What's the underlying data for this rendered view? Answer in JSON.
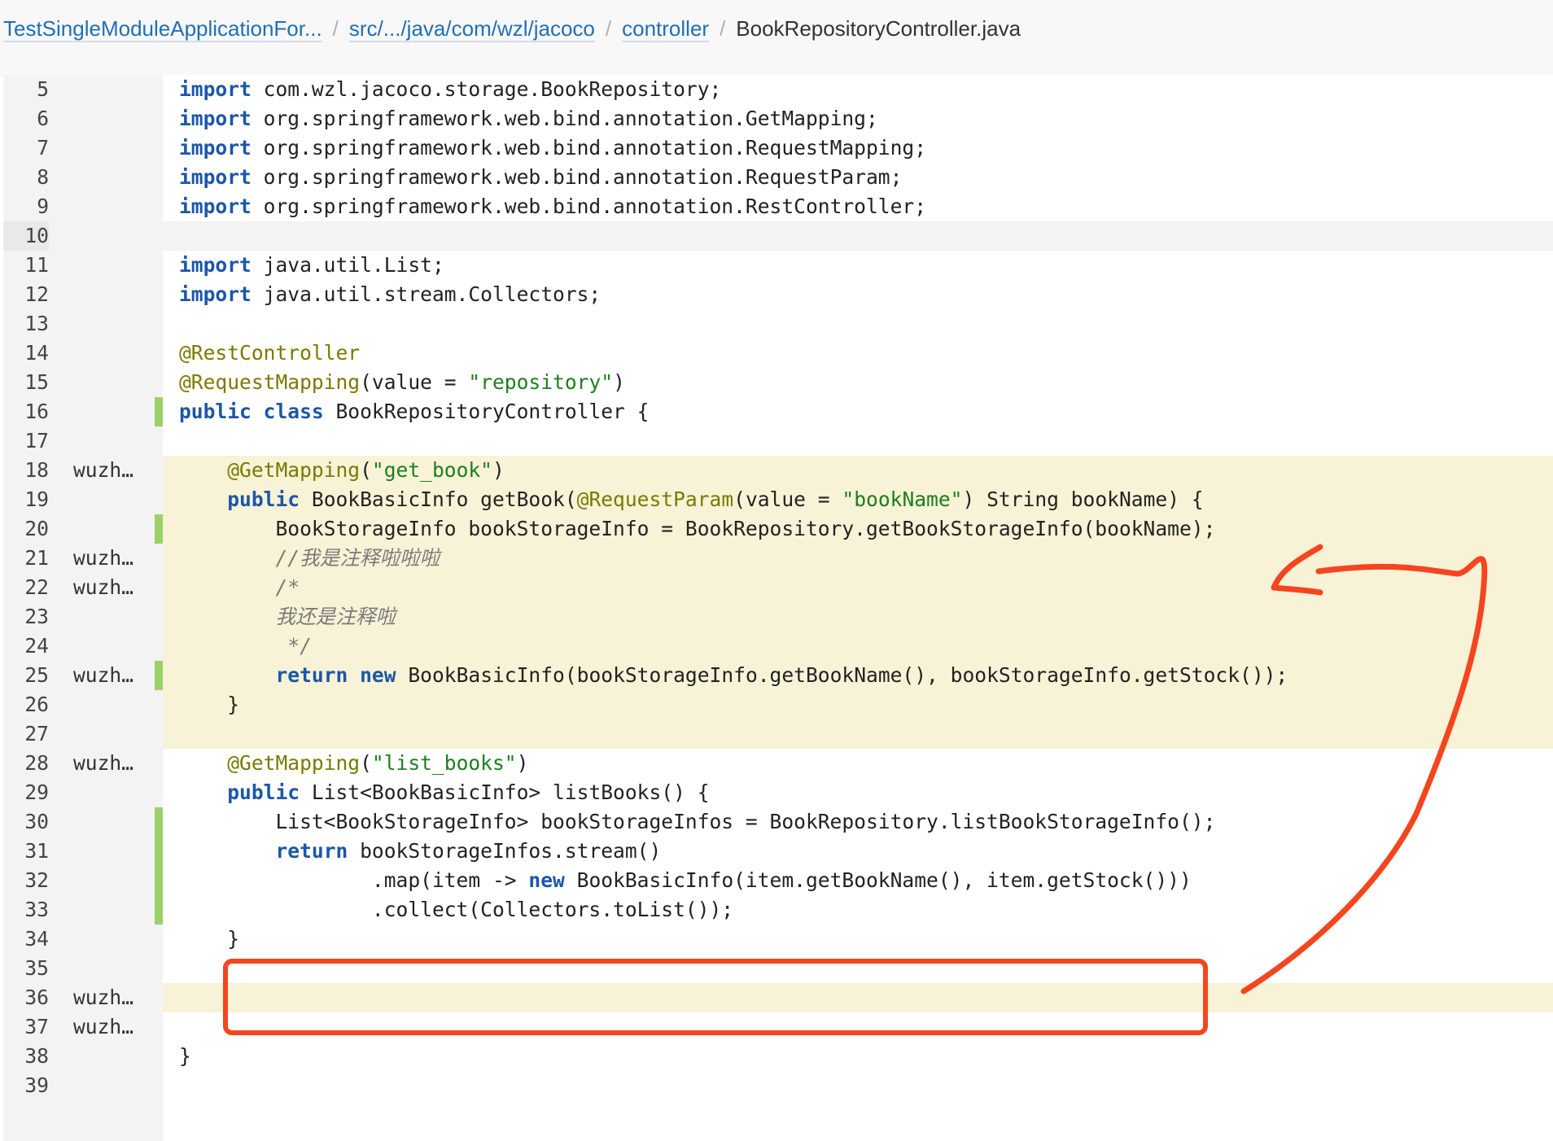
{
  "breadcrumb": {
    "items": [
      "TestSingleModuleApplicationFor...",
      "src/.../java/com/wzl/jacoco",
      "controller"
    ],
    "current": "BookRepositoryController.java",
    "separator": "/"
  },
  "colors": {
    "keyword": "#1b57a8",
    "annotation": "#7a7a00",
    "string": "#1d7f1d",
    "comment": "#7a7a7a",
    "highlight_bg": "#f8f2d6",
    "changed_marker": "#9bd16a",
    "annotation_ink": "#f5451f",
    "link": "#1f6fb6"
  },
  "editor": {
    "lines": [
      {
        "n": "5",
        "author": "",
        "mark": false,
        "hl": false,
        "tokens": [
          [
            "k",
            "import"
          ],
          [
            "t",
            " com.wzl.jacoco.storage.BookRepository;"
          ]
        ]
      },
      {
        "n": "6",
        "author": "",
        "mark": false,
        "hl": false,
        "tokens": [
          [
            "k",
            "import"
          ],
          [
            "t",
            " org.springframework.web.bind.annotation.GetMapping;"
          ]
        ]
      },
      {
        "n": "7",
        "author": "",
        "mark": false,
        "hl": false,
        "tokens": [
          [
            "k",
            "import"
          ],
          [
            "t",
            " org.springframework.web.bind.annotation.RequestMapping;"
          ]
        ]
      },
      {
        "n": "8",
        "author": "",
        "mark": false,
        "hl": false,
        "tokens": [
          [
            "k",
            "import"
          ],
          [
            "t",
            " org.springframework.web.bind.annotation.RequestParam;"
          ]
        ]
      },
      {
        "n": "9",
        "author": "",
        "mark": false,
        "hl": false,
        "tokens": [
          [
            "k",
            "import"
          ],
          [
            "t",
            " org.springframework.web.bind.annotation.RestController;"
          ]
        ]
      },
      {
        "n": "10",
        "author": "",
        "mark": false,
        "hl": false,
        "cur": true,
        "tokens": []
      },
      {
        "n": "11",
        "author": "",
        "mark": false,
        "hl": false,
        "tokens": [
          [
            "k",
            "import"
          ],
          [
            "t",
            " java.util.List;"
          ]
        ]
      },
      {
        "n": "12",
        "author": "",
        "mark": false,
        "hl": false,
        "tokens": [
          [
            "k",
            "import"
          ],
          [
            "t",
            " java.util.stream.Collectors;"
          ]
        ]
      },
      {
        "n": "13",
        "author": "",
        "mark": false,
        "hl": false,
        "tokens": []
      },
      {
        "n": "14",
        "author": "",
        "mark": false,
        "hl": false,
        "tokens": [
          [
            "a",
            "@RestController"
          ]
        ]
      },
      {
        "n": "15",
        "author": "",
        "mark": false,
        "hl": false,
        "tokens": [
          [
            "a",
            "@RequestMapping"
          ],
          [
            "t",
            "(value = "
          ],
          [
            "s",
            "\"repository\""
          ],
          [
            "t",
            ")"
          ]
        ]
      },
      {
        "n": "16",
        "author": "",
        "mark": true,
        "hl": false,
        "tokens": [
          [
            "k",
            "public class"
          ],
          [
            "t",
            " BookRepositoryController {"
          ]
        ]
      },
      {
        "n": "17",
        "author": "",
        "mark": false,
        "hl": false,
        "tokens": []
      },
      {
        "n": "18",
        "author": "wuzh…",
        "mark": false,
        "hl": true,
        "tokens": [
          [
            "t",
            "    "
          ],
          [
            "a",
            "@GetMapping"
          ],
          [
            "t",
            "("
          ],
          [
            "s",
            "\"get_book\""
          ],
          [
            "t",
            ")"
          ]
        ]
      },
      {
        "n": "19",
        "author": "",
        "mark": false,
        "hl": true,
        "tokens": [
          [
            "t",
            "    "
          ],
          [
            "k",
            "public"
          ],
          [
            "t",
            " BookBasicInfo getBook("
          ],
          [
            "a",
            "@RequestParam"
          ],
          [
            "t",
            "(value = "
          ],
          [
            "s",
            "\"bookName\""
          ],
          [
            "t",
            ") String bookName) {"
          ]
        ]
      },
      {
        "n": "20",
        "author": "",
        "mark": true,
        "hl": true,
        "tokens": [
          [
            "t",
            "        BookStorageInfo bookStorageInfo = BookRepository.getBookStorageInfo(bookName);"
          ]
        ]
      },
      {
        "n": "21",
        "author": "wuzh…",
        "mark": false,
        "hl": true,
        "tokens": [
          [
            "t",
            "        "
          ],
          [
            "c",
            "//我是注释啦啦啦"
          ]
        ]
      },
      {
        "n": "22",
        "author": "wuzh…",
        "mark": false,
        "hl": true,
        "tokens": [
          [
            "t",
            "        "
          ],
          [
            "c",
            "/*"
          ]
        ]
      },
      {
        "n": "23",
        "author": "",
        "mark": false,
        "hl": true,
        "tokens": [
          [
            "t",
            "        "
          ],
          [
            "c",
            "我还是注释啦"
          ]
        ]
      },
      {
        "n": "24",
        "author": "",
        "mark": false,
        "hl": true,
        "tokens": [
          [
            "t",
            "         "
          ],
          [
            "c",
            "*/"
          ]
        ]
      },
      {
        "n": "25",
        "author": "wuzh…",
        "mark": true,
        "hl": true,
        "tokens": [
          [
            "t",
            "        "
          ],
          [
            "k",
            "return new"
          ],
          [
            "t",
            " BookBasicInfo(bookStorageInfo.getBookName(), bookStorageInfo.getStock());"
          ]
        ]
      },
      {
        "n": "26",
        "author": "",
        "mark": false,
        "hl": true,
        "tokens": [
          [
            "t",
            "    }"
          ]
        ]
      },
      {
        "n": "27",
        "author": "",
        "mark": false,
        "hl": true,
        "tokens": []
      },
      {
        "n": "28",
        "author": "wuzh…",
        "mark": false,
        "hl": false,
        "tokens": [
          [
            "t",
            "    "
          ],
          [
            "a",
            "@GetMapping"
          ],
          [
            "t",
            "("
          ],
          [
            "s",
            "\"list_books\""
          ],
          [
            "t",
            ")"
          ]
        ]
      },
      {
        "n": "29",
        "author": "",
        "mark": false,
        "hl": false,
        "tokens": [
          [
            "t",
            "    "
          ],
          [
            "k",
            "public"
          ],
          [
            "t",
            " List<BookBasicInfo> listBooks() {"
          ]
        ]
      },
      {
        "n": "30",
        "author": "",
        "mark": true,
        "hl": false,
        "tokens": [
          [
            "t",
            "        List<BookStorageInfo> bookStorageInfos = BookRepository.listBookStorageInfo();"
          ]
        ]
      },
      {
        "n": "31",
        "author": "",
        "mark": true,
        "hl": false,
        "tokens": [
          [
            "t",
            "        "
          ],
          [
            "k",
            "return"
          ],
          [
            "t",
            " bookStorageInfos.stream()"
          ]
        ]
      },
      {
        "n": "32",
        "author": "",
        "mark": true,
        "hl": false,
        "tokens": [
          [
            "t",
            "                .map(item -> "
          ],
          [
            "k",
            "new"
          ],
          [
            "t",
            " BookBasicInfo(item.getBookName(), item.getStock()))"
          ]
        ]
      },
      {
        "n": "33",
        "author": "",
        "mark": true,
        "hl": false,
        "tokens": [
          [
            "t",
            "                .collect(Collectors.toList());"
          ]
        ]
      },
      {
        "n": "34",
        "author": "",
        "mark": false,
        "hl": false,
        "tokens": [
          [
            "t",
            "    }"
          ]
        ]
      },
      {
        "n": "35",
        "author": "",
        "mark": false,
        "hl": false,
        "tokens": []
      },
      {
        "n": "36",
        "author": "wuzh…",
        "mark": false,
        "hl": true,
        "tokens": []
      },
      {
        "n": "37",
        "author": "wuzh…",
        "mark": false,
        "hl": false,
        "tokens": []
      },
      {
        "n": "38",
        "author": "",
        "mark": false,
        "hl": false,
        "tokens": [
          [
            "t",
            "}"
          ]
        ]
      },
      {
        "n": "39",
        "author": "",
        "mark": false,
        "hl": false,
        "tokens": []
      }
    ]
  }
}
